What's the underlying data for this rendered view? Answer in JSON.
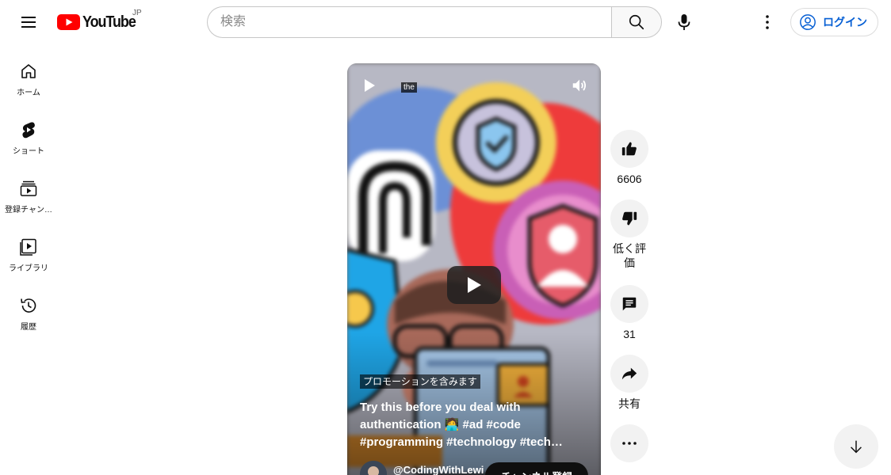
{
  "header": {
    "logo_text": "YouTube",
    "country_code": "JP",
    "search_placeholder": "検索",
    "login_label": "ログイン"
  },
  "sidebar": {
    "items": [
      {
        "label": "ホーム",
        "icon": "home-icon"
      },
      {
        "label": "ショート",
        "icon": "shorts-icon"
      },
      {
        "label": "登録チャン…",
        "icon": "subscriptions-icon"
      },
      {
        "label": "ライブラリ",
        "icon": "library-icon"
      },
      {
        "label": "履歴",
        "icon": "history-icon"
      }
    ]
  },
  "short": {
    "caption_chip": "the",
    "promotion_label": "プロモーションを含みます",
    "title": "Try this before you deal with authentication 🧑‍💻 #ad #code #programming #technology #tech…",
    "channel_name": "@CodingWithLewi",
    "subscribe_label": "チャンネル登録"
  },
  "actions": {
    "like_count": "6606",
    "dislike_label": "低く評価",
    "comment_count": "31",
    "share_label": "共有"
  },
  "colors": {
    "brand_red": "#ff0000",
    "link_blue": "#065fd4",
    "button_gray": "#f2f2f2"
  }
}
